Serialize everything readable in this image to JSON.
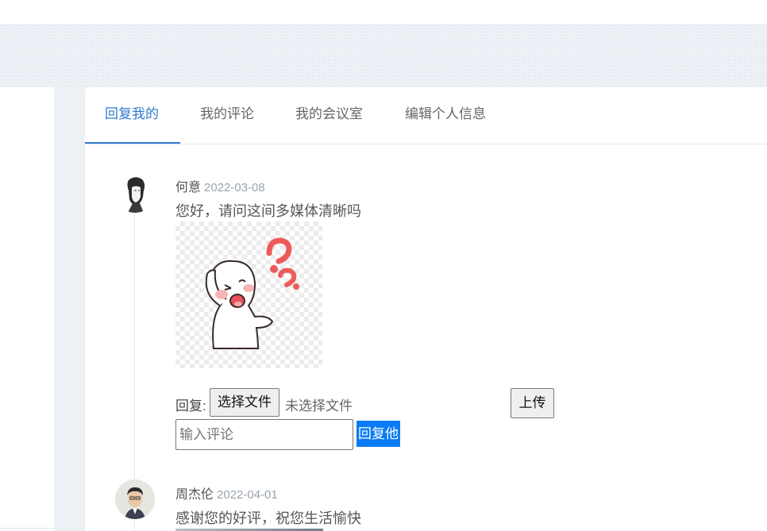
{
  "tabs": [
    {
      "label": "回复我的",
      "active": true
    },
    {
      "label": "我的评论",
      "active": false
    },
    {
      "label": "我的会议室",
      "active": false
    },
    {
      "label": "编辑个人信息",
      "active": false
    }
  ],
  "comments": [
    {
      "author": "何意",
      "date": "2022-03-08",
      "text": "您好，请问这间多媒体清晰吗",
      "image": "question-sticker"
    },
    {
      "author": "周杰伦",
      "date": "2022-04-01",
      "text": "感谢您的好评，祝您生活愉快"
    }
  ],
  "reply_form": {
    "label": "回复:",
    "choose_file": "选择文件",
    "no_file": "未选择文件",
    "upload": "上传",
    "input_placeholder": "输入评论",
    "submit": "回复他"
  },
  "colors": {
    "accent": "#2f7bd1",
    "button_blue": "#0a7cf5",
    "page_bg": "#ecf1f6"
  }
}
